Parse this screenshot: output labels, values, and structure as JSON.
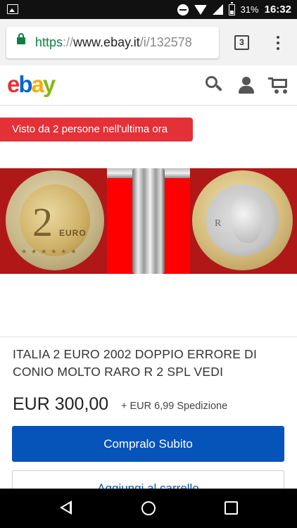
{
  "status_bar": {
    "battery_percent": "31%",
    "time": "16:32"
  },
  "browser": {
    "url_scheme": "https",
    "url_separator": "://",
    "url_host": "www.ebay.it",
    "url_path": "/i/132578",
    "tab_count": "3"
  },
  "header": {
    "logo_letters": [
      "e",
      "b",
      "a",
      "y"
    ],
    "brand_colors": [
      "#e53238",
      "#0064d2",
      "#f5af02",
      "#86b817"
    ]
  },
  "notice": {
    "text": "Visto da 2 persone nell'ultima ora",
    "color": "#e43137"
  },
  "gallery": {
    "coin_digit": "2",
    "coin_label": "EURO",
    "reverse_mark": "R"
  },
  "listing": {
    "title": "ITALIA 2 EURO 2002 DOPPIO ERRORE DI CONIO MOLTO RARO R 2 SPL VEDI",
    "price": "EUR 300,00",
    "shipping": "+ EUR 6,99 Spedizione"
  },
  "actions": {
    "buy_now_label": "Compralo Subito",
    "add_to_cart_label": "Aggiungi al carrello",
    "accent_color": "#0654ba"
  }
}
